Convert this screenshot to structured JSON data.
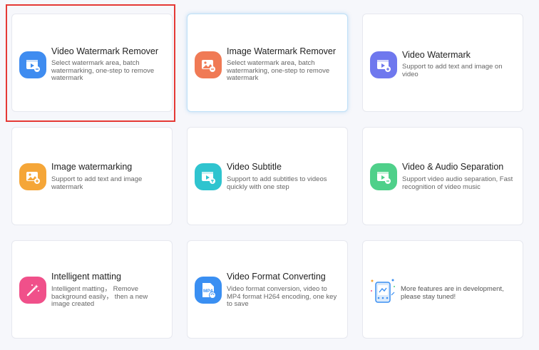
{
  "cards": [
    {
      "title": "Video Watermark Remover",
      "desc": "Select watermark area, batch watermarking, one-step to remove watermark",
      "icon": "video-watermark-remover-icon",
      "color": "#3f8cf0"
    },
    {
      "title": "Image Watermark Remover",
      "desc": "Select watermark area, batch watermarking, one-step to remove watermark",
      "icon": "image-watermark-remover-icon",
      "color": "#f07a55"
    },
    {
      "title": "Video Watermark",
      "desc": "Support to add text and image on video",
      "icon": "video-watermark-icon",
      "color": "#6f78ee"
    },
    {
      "title": "Image watermarking",
      "desc": "Support to add text and image watermark",
      "icon": "image-watermarking-icon",
      "color": "#f5a638"
    },
    {
      "title": "Video Subtitle",
      "desc": "Support to add subtitles to videos quickly with one step",
      "icon": "video-subtitle-icon",
      "color": "#2fc4cf"
    },
    {
      "title": "Video & Audio Separation",
      "desc": "Support video audio separation, Fast recognition of video music",
      "icon": "video-audio-separation-icon",
      "color": "#4fd08a"
    },
    {
      "title": "Intelligent matting",
      "desc": "Intelligent matting， Remove background easily， then a new image created",
      "icon": "magic-wand-icon",
      "color": "#f0508a"
    },
    {
      "title": "Video Format Converting",
      "desc": "Video format conversion, video to MP4 format H264 encoding, one key to save",
      "icon": "mp4-file-icon",
      "color": "#3a8ff2",
      "icon_text": "MP4"
    }
  ],
  "dev_card": {
    "text": "More features are in development, please stay tuned!",
    "icon": "in-development-illustration-icon"
  }
}
